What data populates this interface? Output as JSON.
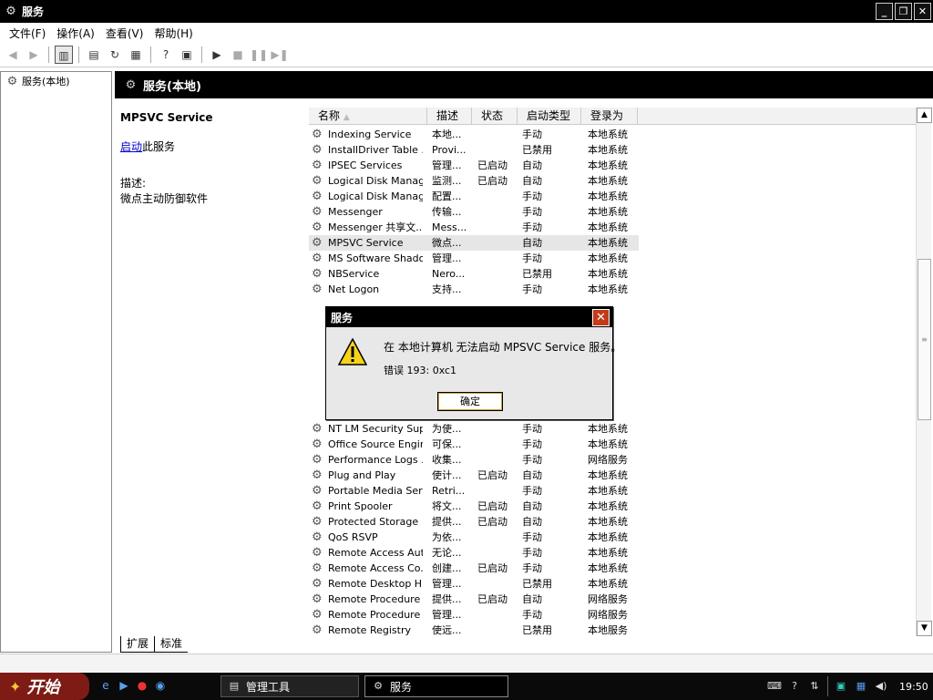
{
  "window": {
    "title": "服务",
    "min_label": "_",
    "restore_label": "❐",
    "close_label": "✕"
  },
  "menu": [
    {
      "label": "文件(F)"
    },
    {
      "label": "操作(A)"
    },
    {
      "label": "查看(V)"
    },
    {
      "label": "帮助(H)"
    }
  ],
  "tree": {
    "root_label": "服务(本地)"
  },
  "header": {
    "title": "服务(本地)"
  },
  "description": {
    "service_name": "MPSVC Service",
    "start_link": "启动",
    "start_suffix": "此服务",
    "desc_label": "描述:",
    "desc_text": "微点主动防御软件"
  },
  "columns": {
    "name": "名称",
    "desc": "描述",
    "status": "状态",
    "startup": "启动类型",
    "logon": "登录为"
  },
  "rows": [
    {
      "name": "Indexing Service",
      "desc": "本地...",
      "status": "",
      "startup": "手动",
      "logon": "本地系统"
    },
    {
      "name": "InstallDriver Table ...",
      "desc": "Provi...",
      "status": "",
      "startup": "已禁用",
      "logon": "本地系统"
    },
    {
      "name": "IPSEC Services",
      "desc": "管理...",
      "status": "已启动",
      "startup": "自动",
      "logon": "本地系统"
    },
    {
      "name": "Logical Disk Manager",
      "desc": "监测...",
      "status": "已启动",
      "startup": "自动",
      "logon": "本地系统"
    },
    {
      "name": "Logical Disk Manag...",
      "desc": "配置...",
      "status": "",
      "startup": "手动",
      "logon": "本地系统"
    },
    {
      "name": "Messenger",
      "desc": "传输...",
      "status": "",
      "startup": "手动",
      "logon": "本地系统"
    },
    {
      "name": "Messenger 共享文...",
      "desc": "Mess...",
      "status": "",
      "startup": "手动",
      "logon": "本地系统"
    },
    {
      "name": "MPSVC Service",
      "desc": "微点...",
      "status": "",
      "startup": "自动",
      "logon": "本地系统"
    },
    {
      "name": "MS Software Shado...",
      "desc": "管理...",
      "status": "",
      "startup": "手动",
      "logon": "本地系统"
    },
    {
      "name": "NBService",
      "desc": "Nero...",
      "status": "",
      "startup": "已禁用",
      "logon": "本地系统"
    },
    {
      "name": "Net Logon",
      "desc": "支持...",
      "status": "",
      "startup": "手动",
      "logon": "本地系统"
    },
    {
      "name": "",
      "desc": "",
      "status": "",
      "startup": "",
      "logon": ""
    },
    {
      "name": "",
      "desc": "",
      "status": "",
      "startup": "",
      "logon": ""
    },
    {
      "name": "",
      "desc": "",
      "status": "",
      "startup": "",
      "logon": ""
    },
    {
      "name": "",
      "desc": "",
      "status": "",
      "startup": "",
      "logon": ""
    },
    {
      "name": "",
      "desc": "",
      "status": "",
      "startup": "",
      "logon": ""
    },
    {
      "name": "",
      "desc": "",
      "status": "",
      "startup": "",
      "logon": ""
    },
    {
      "name": "",
      "desc": "",
      "status": "",
      "startup": "",
      "logon": ""
    },
    {
      "name": "",
      "desc": "",
      "status": "",
      "startup": "",
      "logon": ""
    },
    {
      "name": "NT LM Security Sup...",
      "desc": "为使...",
      "status": "",
      "startup": "手动",
      "logon": "本地系统"
    },
    {
      "name": "Office Source Engine",
      "desc": "可保...",
      "status": "",
      "startup": "手动",
      "logon": "本地系统"
    },
    {
      "name": "Performance Logs ...",
      "desc": "收集...",
      "status": "",
      "startup": "手动",
      "logon": "网络服务"
    },
    {
      "name": "Plug and Play",
      "desc": "使计...",
      "status": "已启动",
      "startup": "自动",
      "logon": "本地系统"
    },
    {
      "name": "Portable Media Seri...",
      "desc": "Retri...",
      "status": "",
      "startup": "手动",
      "logon": "本地系统"
    },
    {
      "name": "Print Spooler",
      "desc": "将文...",
      "status": "已启动",
      "startup": "自动",
      "logon": "本地系统"
    },
    {
      "name": "Protected Storage",
      "desc": "提供...",
      "status": "已启动",
      "startup": "自动",
      "logon": "本地系统"
    },
    {
      "name": "QoS RSVP",
      "desc": "为依...",
      "status": "",
      "startup": "手动",
      "logon": "本地系统"
    },
    {
      "name": "Remote Access Aut...",
      "desc": "无论...",
      "status": "",
      "startup": "手动",
      "logon": "本地系统"
    },
    {
      "name": "Remote Access Co...",
      "desc": "创建...",
      "status": "已启动",
      "startup": "手动",
      "logon": "本地系统"
    },
    {
      "name": "Remote Desktop H...",
      "desc": "管理...",
      "status": "",
      "startup": "已禁用",
      "logon": "本地系统"
    },
    {
      "name": "Remote Procedure ...",
      "desc": "提供...",
      "status": "已启动",
      "startup": "自动",
      "logon": "网络服务"
    },
    {
      "name": "Remote Procedure ...",
      "desc": "管理...",
      "status": "",
      "startup": "手动",
      "logon": "网络服务"
    },
    {
      "name": "Remote Registry",
      "desc": "使远...",
      "status": "",
      "startup": "已禁用",
      "logon": "本地服务"
    }
  ],
  "tabs": [
    {
      "label": "扩展"
    },
    {
      "label": "标准"
    }
  ],
  "dialog": {
    "title": "服务",
    "message": "在 本地计算机 无法启动 MPSVC Service 服务。",
    "error": "错误 193: 0xc1",
    "ok_label": "确定"
  },
  "taskbar": {
    "start_label": "开始",
    "tasks": [
      {
        "label": "管理工具"
      },
      {
        "label": "服务"
      }
    ],
    "clock": "19:50"
  }
}
